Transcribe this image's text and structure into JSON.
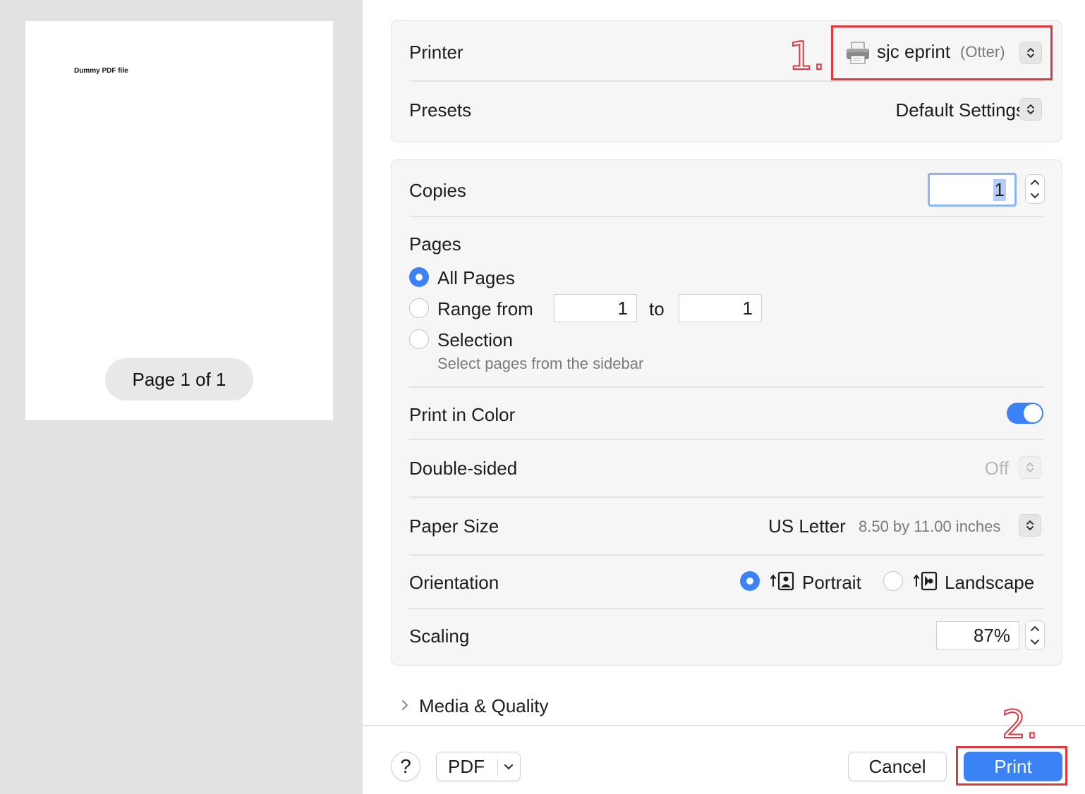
{
  "preview": {
    "thumb_text": "Dummy PDF file",
    "page_indicator": "Page 1 of 1"
  },
  "printer": {
    "label": "Printer",
    "name": "sjc eprint",
    "location": "(Otter)"
  },
  "presets": {
    "label": "Presets",
    "value": "Default Settings"
  },
  "copies": {
    "label": "Copies",
    "value": "1"
  },
  "pages": {
    "label": "Pages",
    "all_label": "All Pages",
    "range_label": "Range from",
    "range_from": "1",
    "to_label": "to",
    "range_to": "1",
    "selection_label": "Selection",
    "selection_hint": "Select pages from the sidebar"
  },
  "color": {
    "label": "Print in Color",
    "on": true
  },
  "double_sided": {
    "label": "Double-sided",
    "value": "Off"
  },
  "paper_size": {
    "label": "Paper Size",
    "value": "US Letter",
    "detail": "8.50 by 11.00 inches"
  },
  "orientation": {
    "label": "Orientation",
    "portrait": "Portrait",
    "landscape": "Landscape"
  },
  "scaling": {
    "label": "Scaling",
    "value": "87%"
  },
  "media_quality": {
    "label": "Media & Quality"
  },
  "footer": {
    "help": "?",
    "pdf": "PDF",
    "cancel": "Cancel",
    "print": "Print"
  },
  "annotations": {
    "step1": "1.",
    "step2": "2."
  },
  "colors": {
    "accent": "#3b82f6",
    "annotation": "#e0383e"
  }
}
